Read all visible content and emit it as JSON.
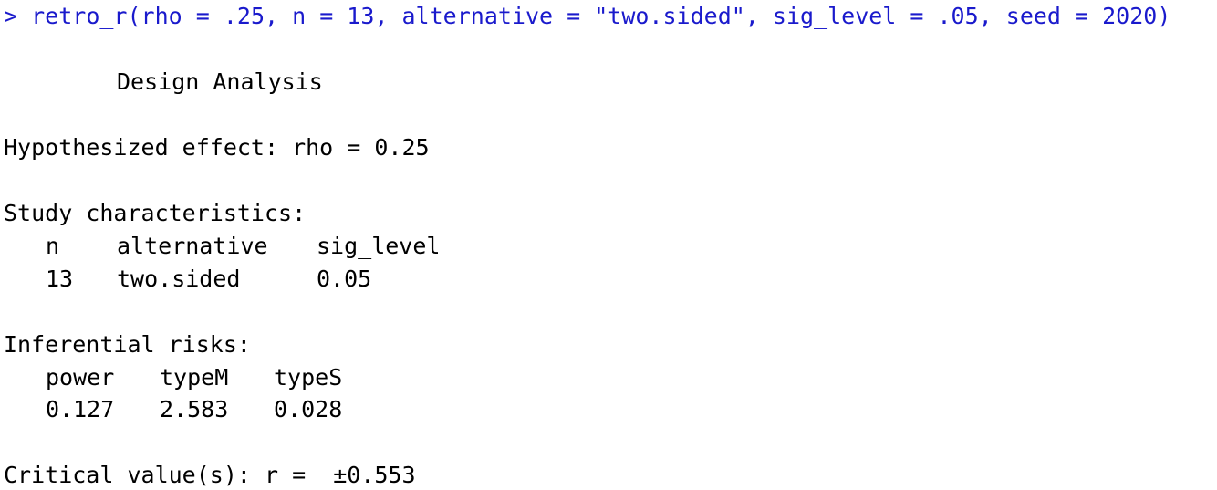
{
  "console": {
    "prompt": ">",
    "command": "retro_r(rho = .25, n = 13, alternative = \"two.sided\", sig_level = .05, seed = 2020)",
    "command_color": "#1a1acc",
    "output": {
      "heading": "Design Analysis",
      "hypothesized_effect": "Hypothesized effect: rho = 0.25",
      "study_title": "Study characteristics:",
      "study_table": {
        "headers": [
          "n",
          "alternative",
          "sig_level"
        ],
        "values": [
          "13",
          "two.sided",
          "0.05"
        ]
      },
      "risks_title": "Inferential risks:",
      "risks_table": {
        "headers": [
          "power",
          "typeM",
          "typeS"
        ],
        "values": [
          "0.127",
          "2.583",
          "0.028"
        ]
      },
      "critical_value": "Critical value(s): r =  ±0.553"
    }
  }
}
